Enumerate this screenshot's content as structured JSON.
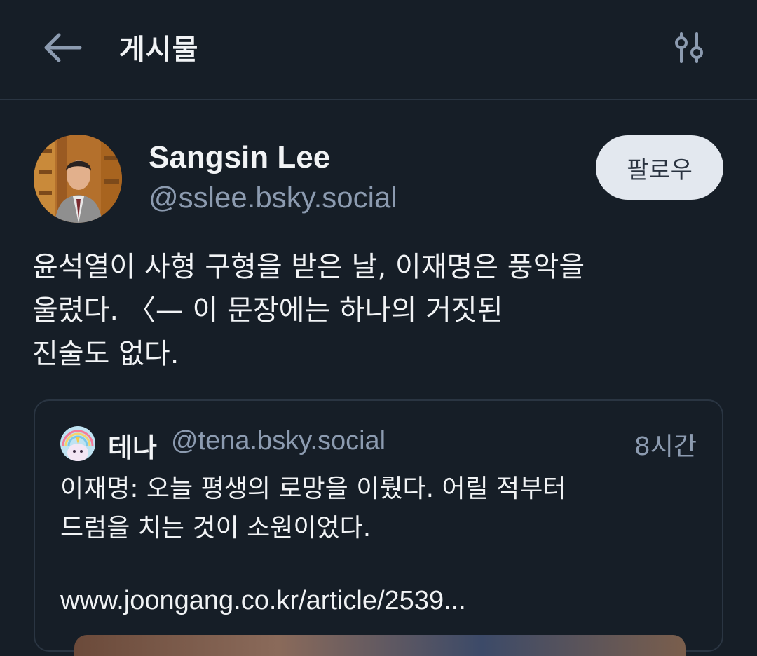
{
  "header": {
    "title": "게시물"
  },
  "post": {
    "author_name": "Sangsin Lee",
    "author_handle": "@sslee.bsky.social",
    "follow_label": "팔로우",
    "text": "윤석열이 사형 구형을 받은 날, 이재명은 풍악을\n울렸다. 〈— 이 문장에는 하나의 거짓된\n진술도 없다."
  },
  "quote": {
    "author_name": "테나",
    "author_handle": "@tena.bsky.social",
    "time": "8시간",
    "text": "이재명: 오늘 평생의 로망을 이뤘다. 어릴 적부터\n드럼을 치는 것이 소원이었다.",
    "link": "www.joongang.co.kr/article/2539..."
  },
  "icons": {
    "back": "arrow-left-icon",
    "filter": "sliders-icon"
  },
  "colors": {
    "background": "#161e27",
    "follow_button": "#e3e8ef",
    "muted_text": "#8c9bb0"
  }
}
